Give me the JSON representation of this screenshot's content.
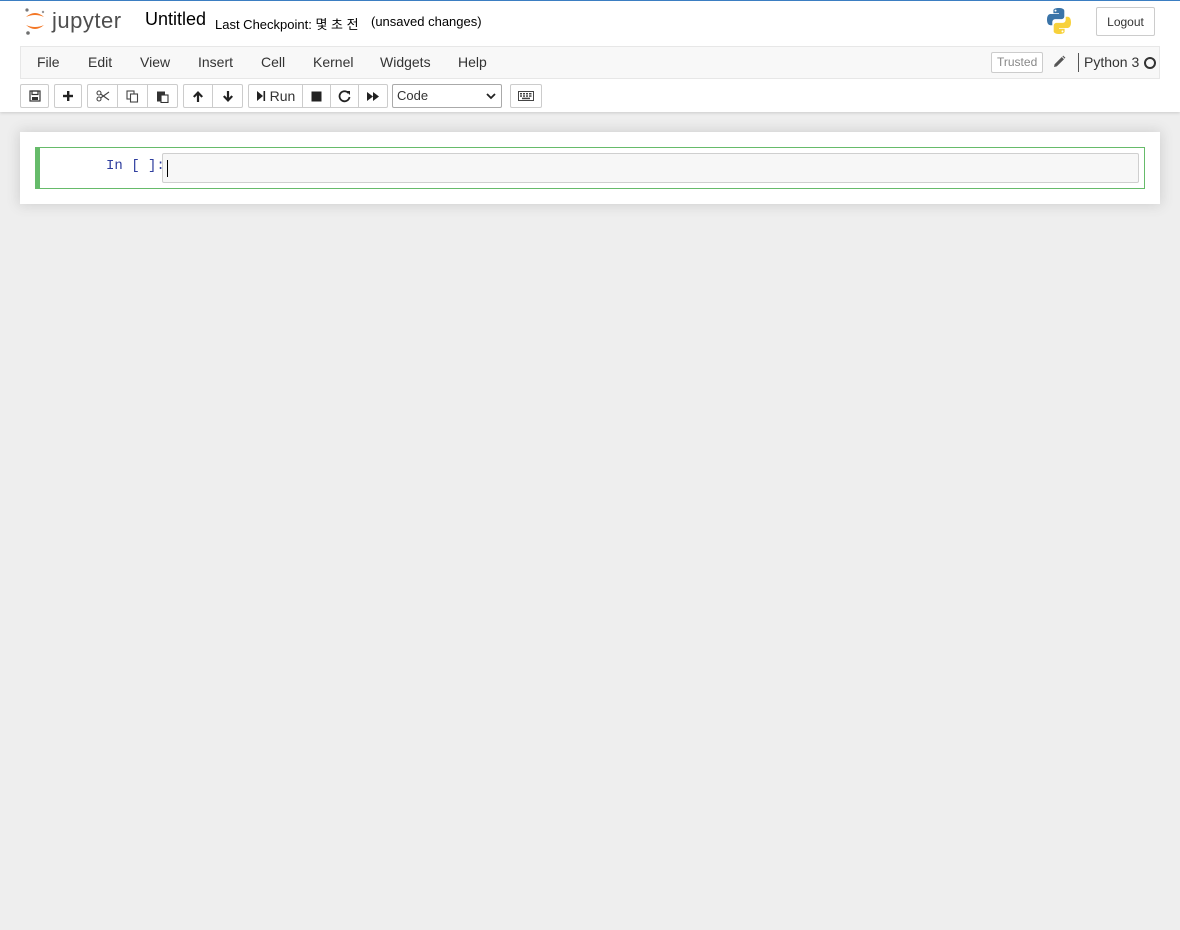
{
  "header": {
    "logo_text": "jupyter",
    "notebook_name": "Untitled",
    "checkpoint": "Last Checkpoint: 몇 초 전",
    "autosave_status": "(unsaved changes)",
    "logout_label": "Logout"
  },
  "menubar": {
    "items": [
      {
        "label": "File"
      },
      {
        "label": "Edit"
      },
      {
        "label": "View"
      },
      {
        "label": "Insert"
      },
      {
        "label": "Cell"
      },
      {
        "label": "Kernel"
      },
      {
        "label": "Widgets"
      },
      {
        "label": "Help"
      }
    ],
    "trusted_label": "Trusted",
    "kernel_name": "Python 3"
  },
  "toolbar": {
    "run_label": "Run",
    "cell_type": "Code",
    "icons": [
      "save-icon",
      "plus-icon",
      "cut-icon",
      "copy-icon",
      "paste-icon",
      "arrow-up-icon",
      "arrow-down-icon",
      "run-icon",
      "stop-icon",
      "restart-icon",
      "fast-forward-icon",
      "keyboard-icon"
    ]
  },
  "cell": {
    "prompt": "In [ ]:",
    "source": ""
  },
  "colors": {
    "accent_blue": "#3b7ec2",
    "cell_selected_green": "#66bb6a",
    "prompt_blue": "#303f9f",
    "logo_orange": "#f37726"
  }
}
